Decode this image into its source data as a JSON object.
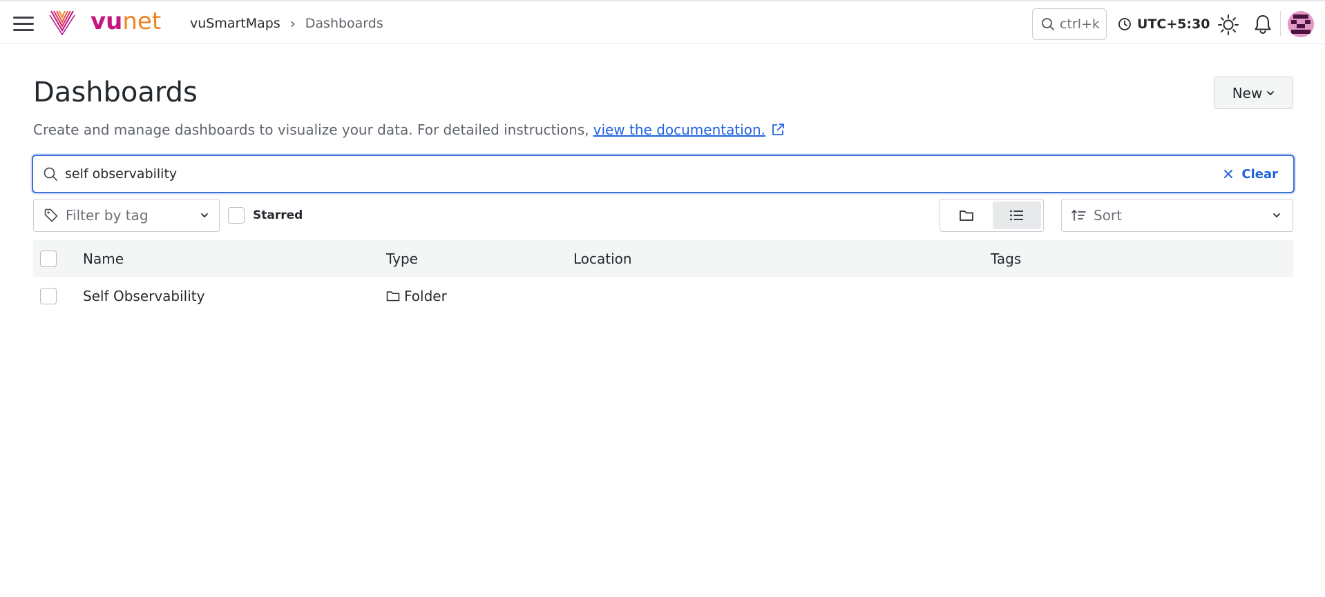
{
  "app": {
    "logo_vu": "vu",
    "logo_net": "net"
  },
  "breadcrumb": {
    "root": "vuSmartMaps",
    "separator": "›",
    "current": "Dashboards"
  },
  "topbar": {
    "search_hint": "ctrl+k",
    "timezone": "UTC+5:30"
  },
  "page": {
    "title": "Dashboards",
    "description": "Create and manage dashboards to visualize your data. For detailed instructions,",
    "doc_link": "view the documentation.",
    "new_button": "New"
  },
  "search": {
    "value": "self observability",
    "clear_label": "Clear"
  },
  "filters": {
    "tag_placeholder": "Filter by tag",
    "starred_label": "Starred",
    "sort_placeholder": "Sort",
    "view_mode": "list"
  },
  "table": {
    "columns": {
      "name": "Name",
      "type": "Type",
      "location": "Location",
      "tags": "Tags"
    },
    "rows": [
      {
        "name": "Self Observability",
        "type": "Folder",
        "location": "",
        "tags": ""
      }
    ]
  },
  "colors": {
    "brand_magenta": "#c4147d",
    "brand_orange": "#f0851e",
    "accent_blue": "#1f62e0"
  }
}
